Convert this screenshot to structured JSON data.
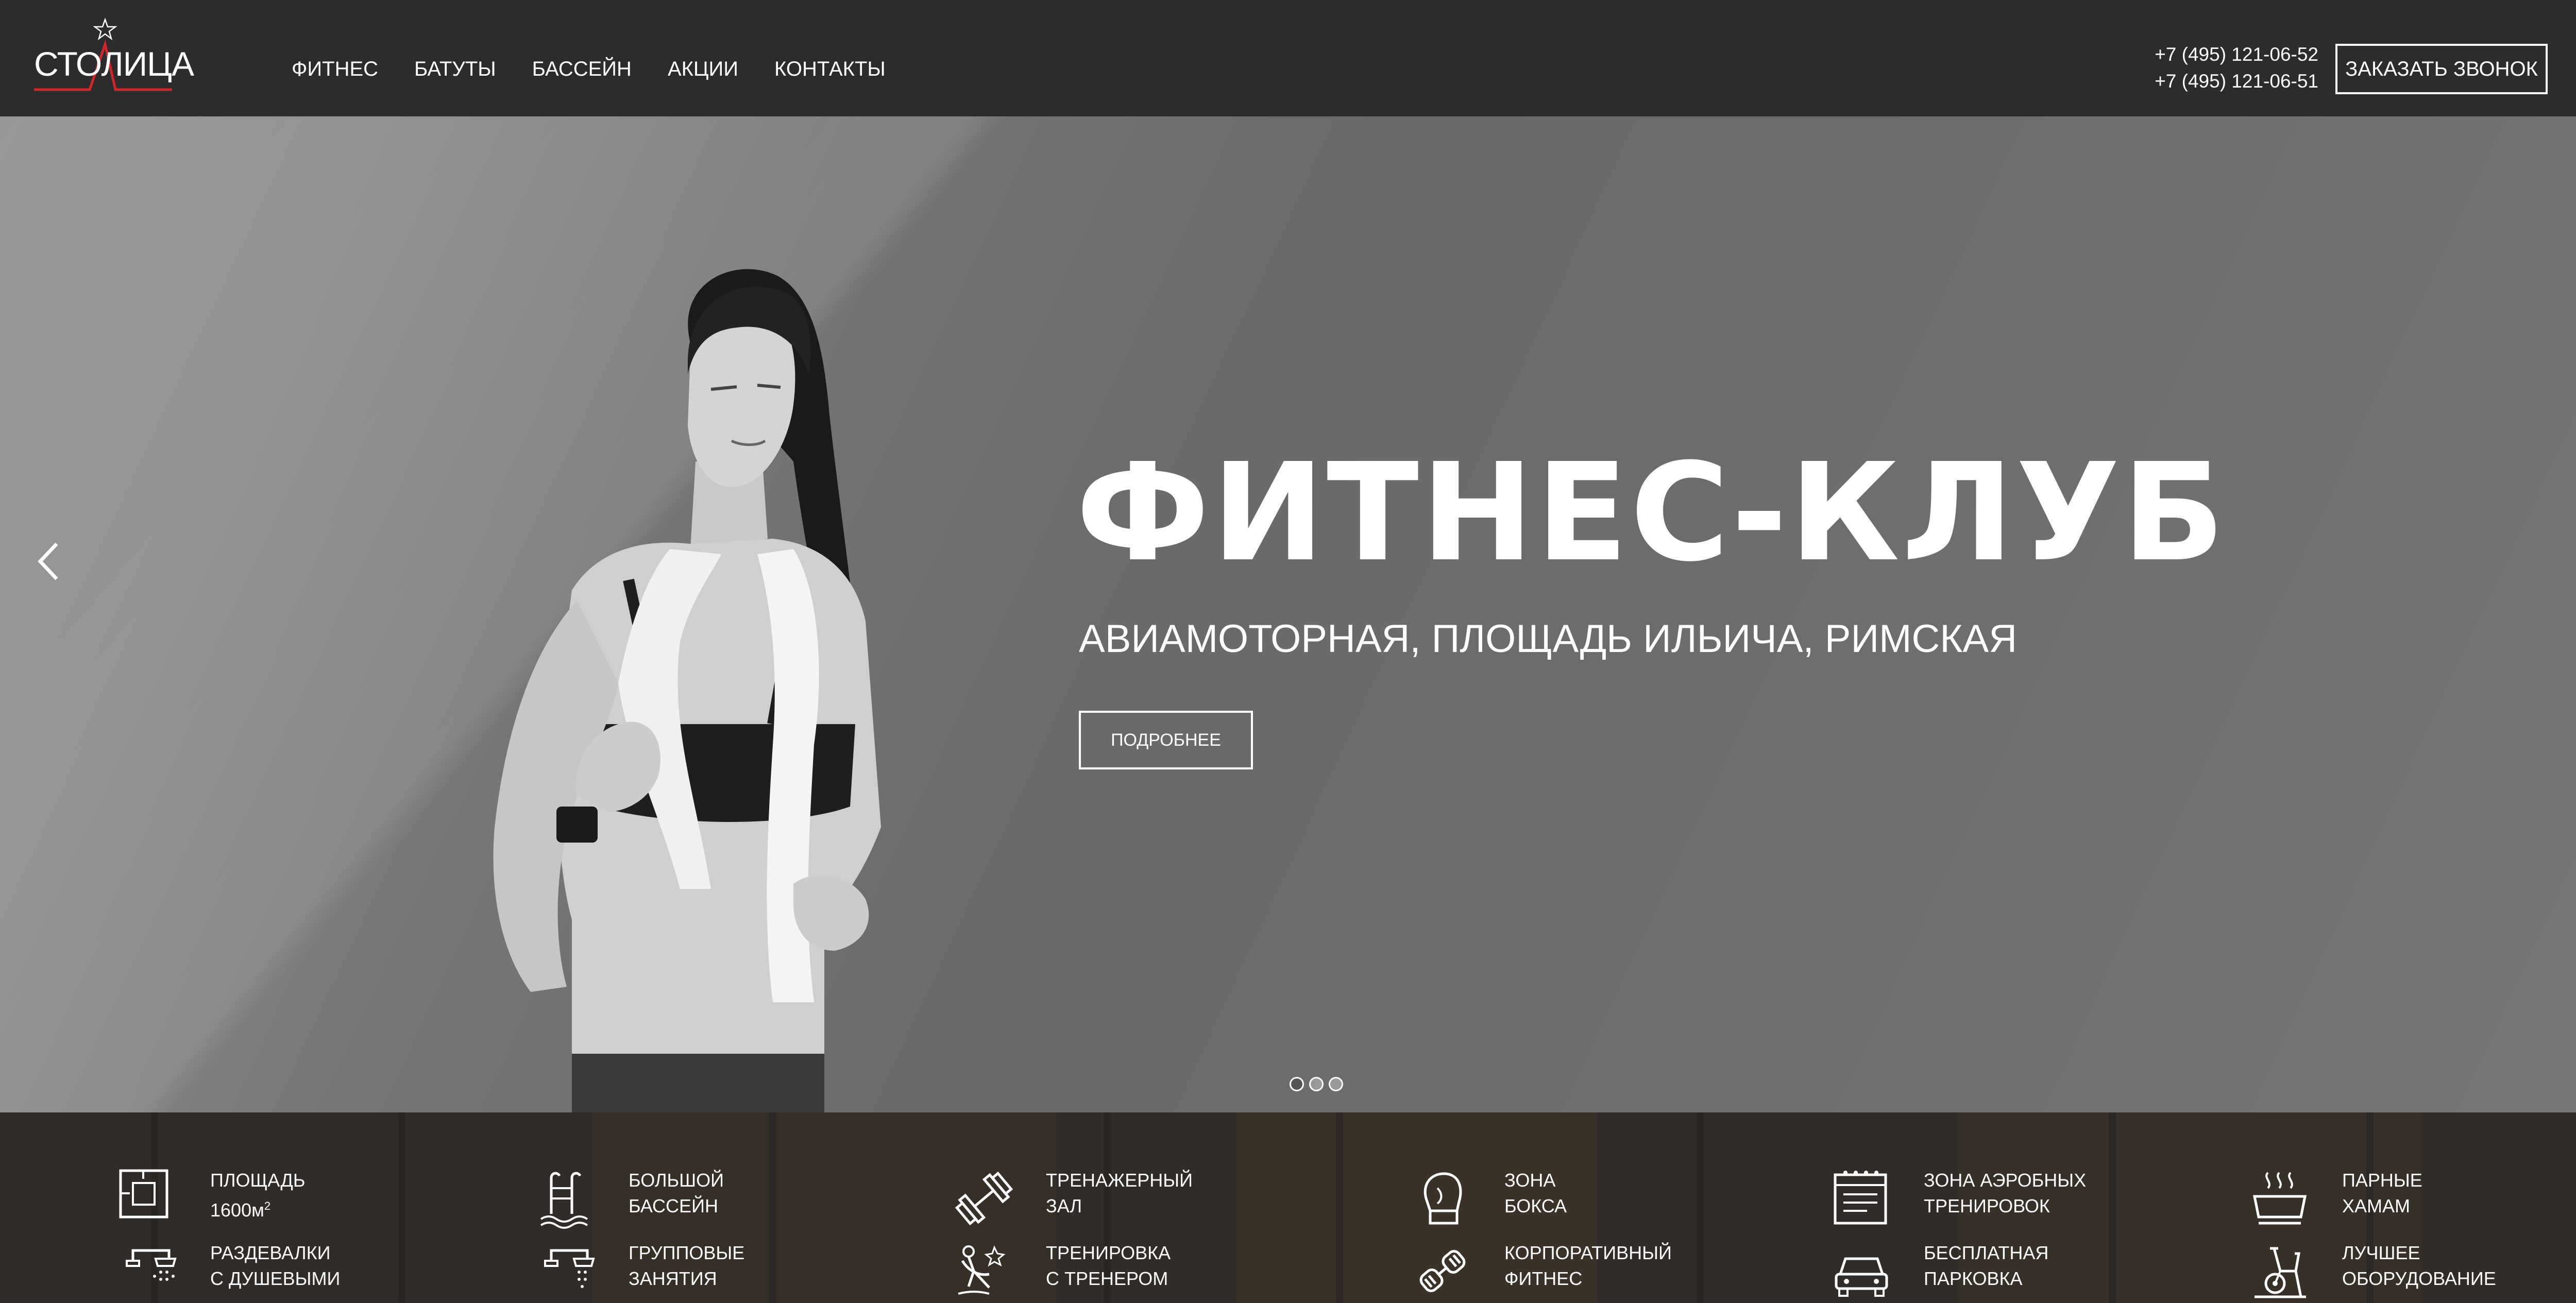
{
  "header": {
    "logo_text": "СТОЛИЦА",
    "nav": [
      "ФИТНЕС",
      "БАТУТЫ",
      "БАССЕЙН",
      "АКЦИИ",
      "КОНТАКТЫ"
    ],
    "phones": [
      "+7 (495) 121-06-52",
      "+7 (495) 121-06-51"
    ],
    "callback_label": "ЗАКАЗАТЬ ЗВОНОК"
  },
  "hero": {
    "title": "ФИТНЕС-КЛУБ",
    "subtitle": "АВИАМОТОРНАЯ, ПЛОЩАДЬ ИЛЬИЧА, РИМСКАЯ",
    "button_label": "ПОДРОБНЕЕ",
    "slides_count": 3,
    "active_slide": 1
  },
  "features": [
    {
      "icon": "floor-plan-icon",
      "line1": "ПЛОЩАДЬ",
      "line2": "1600м",
      "sup": "2"
    },
    {
      "icon": "pool-icon",
      "line1": "БОЛЬШОЙ",
      "line2": "БАССЕЙН"
    },
    {
      "icon": "dumbbell-icon",
      "line1": "ТРЕНАЖЕРНЫЙ",
      "line2": "ЗАЛ"
    },
    {
      "icon": "boxing-glove-icon",
      "line1": "ЗОНА",
      "line2": "БОКСА"
    },
    {
      "icon": "aerobics-board-icon",
      "line1": "ЗОНА АЭРОБНЫХ",
      "line2": "ТРЕНИРОВОК"
    },
    {
      "icon": "steam-icon",
      "line1": "ПАРНЫЕ",
      "line2": "ХАМАМ"
    },
    {
      "icon": "shower-icon",
      "line1": "РАЗДЕВАЛКИ",
      "line2": "С ДУШЕВЫМИ"
    },
    {
      "icon": "shower-group-icon",
      "line1": "ГРУППОВЫЕ",
      "line2": "ЗАНЯТИЯ"
    },
    {
      "icon": "trainer-icon",
      "line1": "ТРЕНИРОВКА",
      "line2": "С ТРЕНЕРОМ"
    },
    {
      "icon": "hand-grip-icon",
      "line1": "КОРПОРАТИВНЫЙ",
      "line2": "ФИТНЕС"
    },
    {
      "icon": "car-icon",
      "line1": "БЕСПЛАТНАЯ",
      "line2": "ПАРКОВКА"
    },
    {
      "icon": "exercise-bike-icon",
      "line1": "ЛУЧШЕЕ",
      "line2": "ОБОРУДОВАНИЕ"
    }
  ],
  "colors": {
    "header_bg": "#2c2c2c",
    "logo_accent": "#d0262b",
    "text": "#ffffff"
  }
}
